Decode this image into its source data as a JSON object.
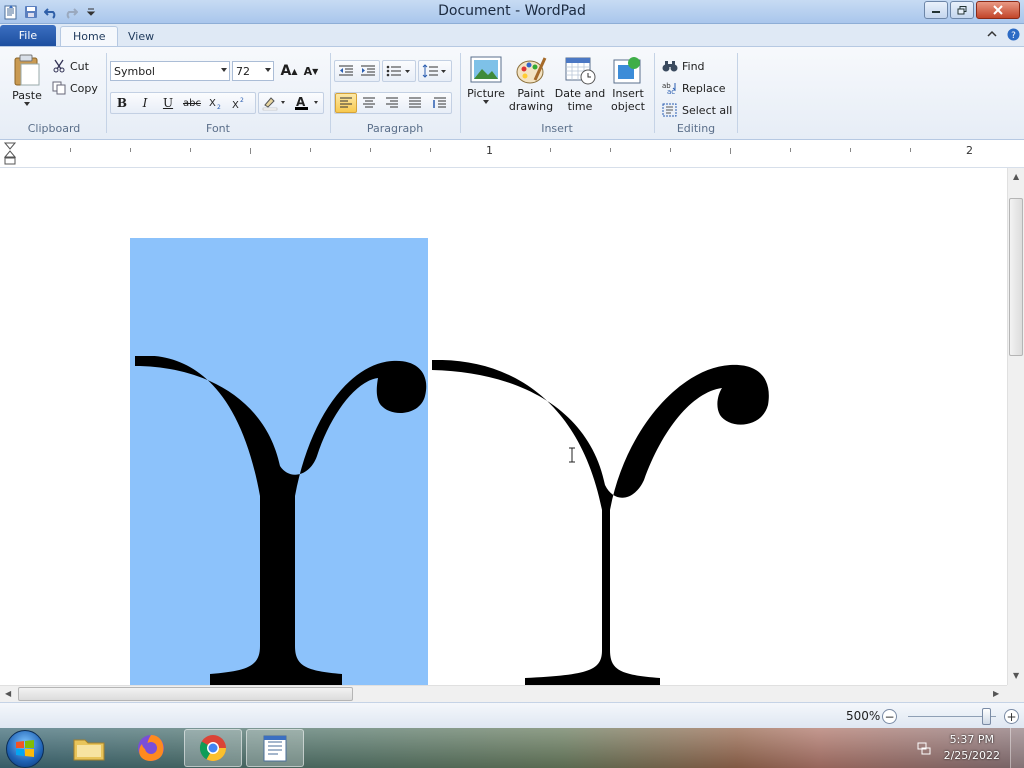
{
  "window": {
    "title": "Document - WordPad"
  },
  "tabs": {
    "file": "File",
    "home": "Home",
    "view": "View"
  },
  "clipboard": {
    "paste": "Paste",
    "cut": "Cut",
    "copy": "Copy",
    "label": "Clipboard"
  },
  "font": {
    "family": "Symbol",
    "size": "72",
    "label": "Font",
    "bold": "B",
    "italic": "I",
    "underline": "U",
    "strikethrough": "abc",
    "grow": "A",
    "shrink": "A"
  },
  "paragraph": {
    "label": "Paragraph"
  },
  "insert": {
    "picture": "Picture",
    "paint_drawing": [
      "Paint",
      "drawing"
    ],
    "date_time": [
      "Date and",
      "time"
    ],
    "insert_object": [
      "Insert",
      "object"
    ],
    "label": "Insert"
  },
  "editing": {
    "find": "Find",
    "replace": "Replace",
    "select_all": "Select all",
    "label": "Editing"
  },
  "ruler": {
    "numbers": [
      "1",
      "2"
    ]
  },
  "document": {
    "glyph": "ϒ",
    "glyph_name": "upsilon-hook-symbol"
  },
  "status": {
    "zoom": "500%",
    "zoom_level": 0.85
  },
  "taskbar": {
    "time": "5:37 PM",
    "date": "2/25/2022",
    "apps": [
      "start",
      "file-explorer",
      "firefox",
      "chrome",
      "wordpad"
    ]
  },
  "colors": {
    "selection": "#8cc2fb",
    "file_tab": "#2a5db0",
    "active_alignment": "#f8c94f"
  }
}
